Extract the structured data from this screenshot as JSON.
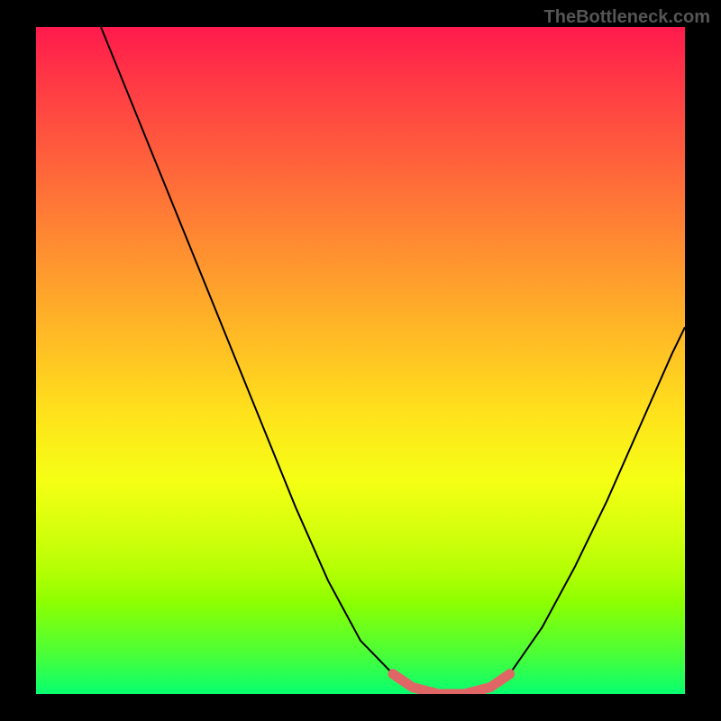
{
  "watermark": "TheBottleneck.com",
  "chart_data": {
    "type": "line",
    "title": "",
    "xlabel": "",
    "ylabel": "",
    "xlim": [
      0,
      100
    ],
    "ylim": [
      0,
      100
    ],
    "grid": false,
    "series": [
      {
        "name": "black-curve",
        "color": "#000000",
        "points": [
          {
            "x": 10,
            "y": 100
          },
          {
            "x": 15,
            "y": 88
          },
          {
            "x": 20,
            "y": 76
          },
          {
            "x": 25,
            "y": 64
          },
          {
            "x": 30,
            "y": 52
          },
          {
            "x": 35,
            "y": 40
          },
          {
            "x": 40,
            "y": 28
          },
          {
            "x": 45,
            "y": 17
          },
          {
            "x": 50,
            "y": 8
          },
          {
            "x": 55,
            "y": 3
          },
          {
            "x": 58,
            "y": 1
          },
          {
            "x": 62,
            "y": 0
          },
          {
            "x": 66,
            "y": 0
          },
          {
            "x": 70,
            "y": 1
          },
          {
            "x": 73,
            "y": 3
          },
          {
            "x": 78,
            "y": 10
          },
          {
            "x": 83,
            "y": 19
          },
          {
            "x": 88,
            "y": 29
          },
          {
            "x": 93,
            "y": 40
          },
          {
            "x": 98,
            "y": 51
          },
          {
            "x": 100,
            "y": 55
          }
        ]
      },
      {
        "name": "pink-overlay",
        "color": "#e06666",
        "points": [
          {
            "x": 55,
            "y": 3
          },
          {
            "x": 58,
            "y": 1
          },
          {
            "x": 62,
            "y": 0
          },
          {
            "x": 66,
            "y": 0
          },
          {
            "x": 70,
            "y": 1
          },
          {
            "x": 73,
            "y": 3
          }
        ]
      }
    ],
    "legend": false
  }
}
